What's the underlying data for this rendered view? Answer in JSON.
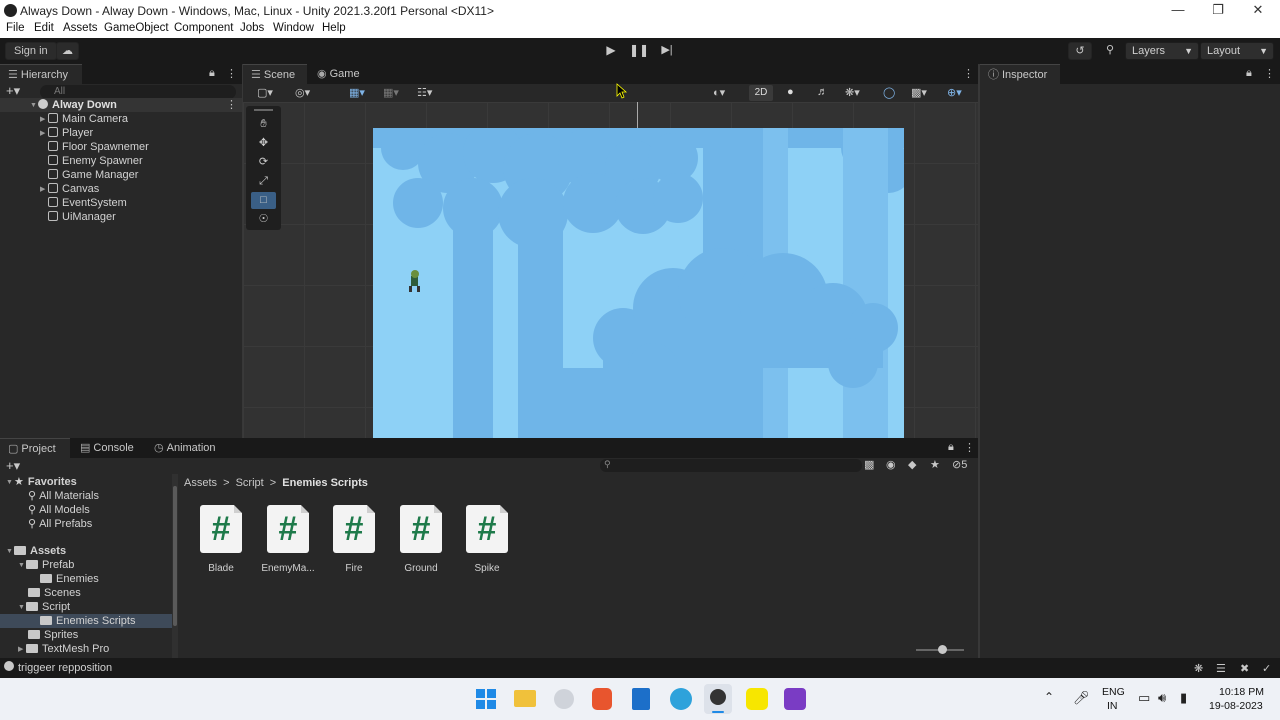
{
  "window": {
    "title": "Always  Down - Alway Down - Windows, Mac, Linux - Unity 2021.3.20f1 Personal <DX11>"
  },
  "menu": [
    "File",
    "Edit",
    "Assets",
    "GameObject",
    "Component",
    "Jobs",
    "Window",
    "Help"
  ],
  "toolbar": {
    "sign_in": "Sign in",
    "layers": "Layers",
    "layout": "Layout"
  },
  "hierarchy": {
    "tab": "Hierarchy",
    "search_placeholder": "All",
    "scene_name": "Alway Down",
    "items": [
      "Main Camera",
      "Player",
      "Floor Spawnemer",
      "Enemy Spawner",
      "Game Manager",
      "Canvas",
      "EventSystem",
      "UiManager"
    ]
  },
  "scene": {
    "tabs": {
      "scene": "Scene",
      "game": "Game"
    },
    "mode_2d": "2D"
  },
  "inspector": {
    "tab": "Inspector"
  },
  "project": {
    "tabs": {
      "project": "Project",
      "console": "Console",
      "animation": "Animation"
    },
    "favorites_label": "Favorites",
    "favorites": [
      "All Materials",
      "All Models",
      "All Prefabs"
    ],
    "assets_label": "Assets",
    "tree": {
      "prefab": "Prefab",
      "enemies": "Enemies",
      "scenes": "Scenes",
      "script": "Script",
      "enemies_scripts": "Enemies Scripts",
      "sprites": "Sprites",
      "textmesh": "TextMesh Pro"
    },
    "breadcrumb": {
      "a": "Assets",
      "b": "Script",
      "c": "Enemies Scripts"
    },
    "hidden_count": "5",
    "assets": [
      "Blade",
      "EnemyMa...",
      "Fire",
      "Ground",
      "Spike"
    ],
    "asset_glyph": "#"
  },
  "status": {
    "message": "triggeer repposition"
  },
  "taskbar": {
    "lang": "ENG",
    "region": "IN",
    "time": "10:18 PM",
    "date": "19-08-2023"
  }
}
